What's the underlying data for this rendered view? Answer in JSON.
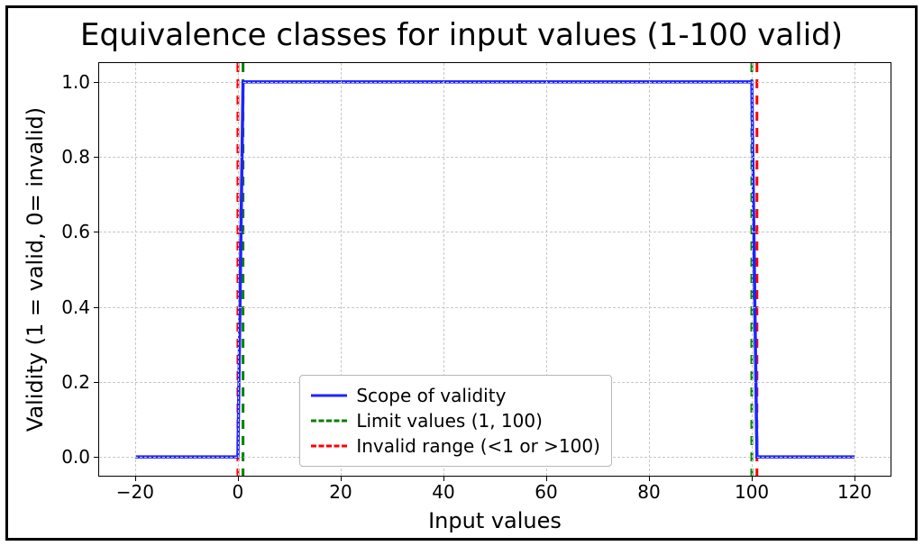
{
  "title": "Equivalence classes for input values (1-100 valid)",
  "xlabel": "Input values",
  "ylabel": "Validity (1 = valid, 0= invalid)",
  "legend": {
    "items": [
      {
        "name": "scope",
        "label": "Scope of validity",
        "color": "#1f24ff",
        "style": "solid"
      },
      {
        "name": "limit",
        "label": "Limit values (1, 100)",
        "color": "#008000",
        "style": "dashed"
      },
      {
        "name": "invalid",
        "label": "Invalid range (<1 or >100)",
        "color": "#ff0000",
        "style": "dashed"
      }
    ]
  },
  "axes": {
    "x_ticks": [
      -20,
      0,
      20,
      40,
      60,
      80,
      100,
      120
    ],
    "y_ticks": [
      0.0,
      0.2,
      0.4,
      0.6,
      0.8,
      1.0
    ],
    "xlim": [
      -27,
      127
    ],
    "ylim": [
      -0.05,
      1.05
    ]
  },
  "chart_data": {
    "type": "line",
    "title": "Equivalence classes for input values (1-100 valid)",
    "xlabel": "Input values",
    "ylabel": "Validity (1 = valid, 0= invalid)",
    "xlim": [
      -27,
      127
    ],
    "ylim": [
      -0.05,
      1.05
    ],
    "grid": true,
    "legend_position": "lower center",
    "x": [
      -20,
      0,
      1,
      100,
      101,
      120
    ],
    "series": [
      {
        "name": "Scope of validity",
        "color": "#1f24ff",
        "style": "solid",
        "values": [
          0,
          0,
          1,
          1,
          0,
          0
        ]
      }
    ],
    "vlines": [
      {
        "name": "Limit values (1, 100)",
        "color": "#008000",
        "style": "dashed",
        "x": [
          1,
          100
        ]
      },
      {
        "name": "Invalid range (<1 or >100)",
        "color": "#ff0000",
        "style": "dashed",
        "x": [
          0,
          101
        ]
      }
    ]
  }
}
